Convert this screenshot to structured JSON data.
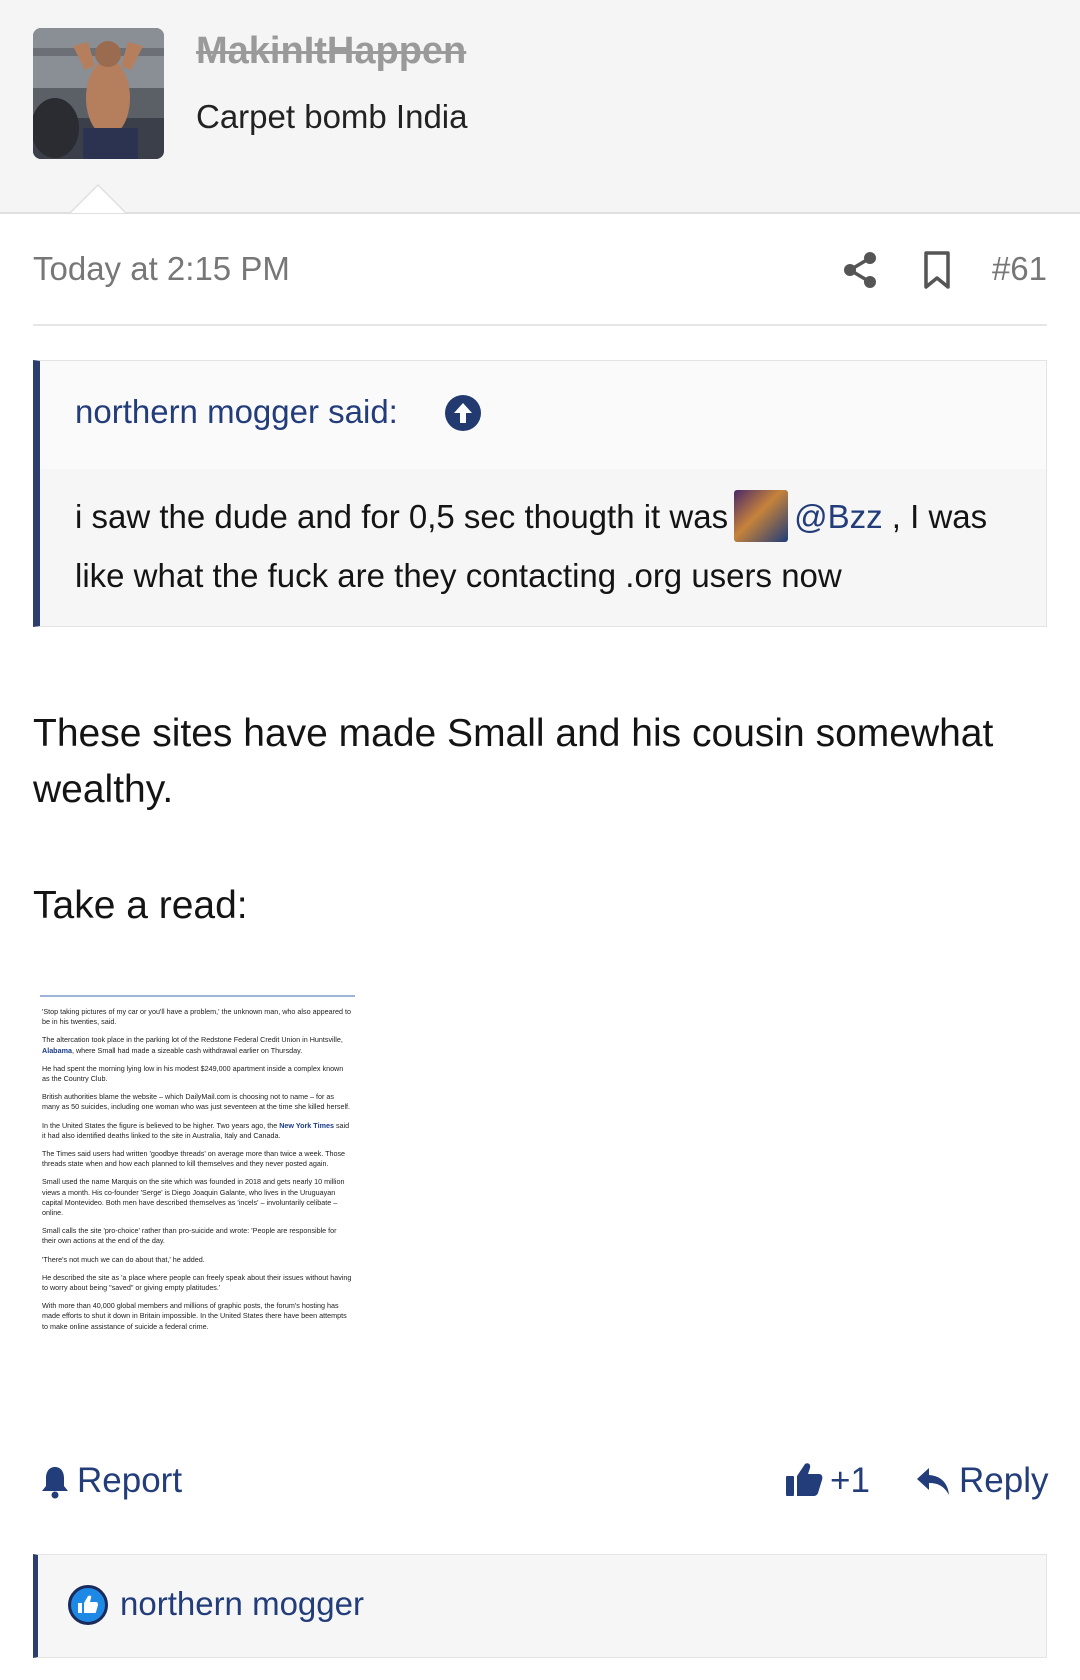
{
  "user": {
    "name": "MakinItHappen",
    "title": "Carpet bomb India"
  },
  "meta": {
    "timestamp": "Today at 2:15 PM",
    "post_number": "#61"
  },
  "quote": {
    "author": "northern mogger said:",
    "body_before": "i saw the dude and for 0,5 sec thougth it was",
    "mention": "@Bzz",
    "body_after": ", I was like what the fuck are they contacting .org users now"
  },
  "post": {
    "paragraph1": "These sites have made Small and his cousin somewhat wealthy.",
    "paragraph2": "Take a read:"
  },
  "article": {
    "p1": "'Stop taking pictures of my car or you'll have a problem,' the unknown man, who also appeared to be in his twenties, said.",
    "p2a": "The altercation took place in the parking lot of the Redstone Federal Credit Union in Huntsville,",
    "p2_link": "Alabama",
    "p2b": ", where Small had made a sizeable cash withdrawal earlier on Thursday.",
    "p3": "He had spent the morning lying low in his modest $249,000 apartment inside a complex known as the Country Club.",
    "p4": "British authorities blame the website – which DailyMail.com is choosing not to name – for as many as 50 suicides, including one woman who was just seventeen at the time she killed herself.",
    "p5a": "In the United States the figure is believed to be higher. Two years ago, the",
    "p5_link": "New York Times",
    "p5b": "said it had also identified deaths linked to the site in Australia, Italy and Canada.",
    "p6": "The Times said users had written 'goodbye threads' on average more than twice a week. Those threads state when and how each planned to kill themselves and they never posted again.",
    "p7": "Small used the name Marquis on the site which was founded in 2018 and gets nearly 10 million views a month. His co-founder 'Serge' is Diego Joaquin Galante, who lives in the Uruguayan capital Montevideo. Both men have described themselves as 'incels' – involuntarily celibate – online.",
    "p8": "Small calls the site 'pro-choice' rather than pro-suicide and wrote: 'People are responsible for their own actions at the end of the day.",
    "p9": "'There's not much we can do about that,' he added.",
    "p10": "He described the site as 'a place where people can freely speak about their issues without having to worry about being \"saved\" or giving empty platitudes.'",
    "p11": "With more than 40,000 global members and millions of graphic posts, the forum's hosting has made efforts to shut it down in Britain impossible. In the United States there have been attempts to make online assistance of suicide a federal crime."
  },
  "actions": {
    "report": "Report",
    "like_count": "+1",
    "reply": "Reply"
  },
  "reactions": {
    "user": "northern mogger"
  },
  "colors": {
    "accent": "#233d7a",
    "quote_border": "#2c3e6e",
    "meta_text": "#777777"
  },
  "icons": [
    "share-icon",
    "bookmark-icon",
    "arrow-up-circle-icon",
    "bell-icon",
    "thumbs-up-icon",
    "reply-icon",
    "like-reaction-icon"
  ]
}
